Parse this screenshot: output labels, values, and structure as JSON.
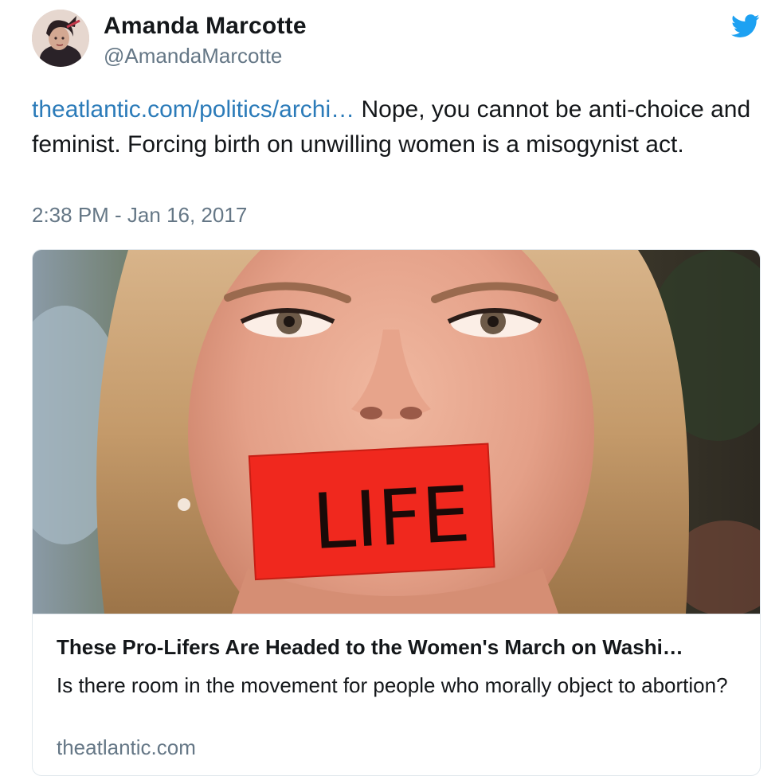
{
  "author": {
    "display_name": "Amanda Marcotte",
    "handle": "@AmandaMarcotte"
  },
  "tweet": {
    "link_text": "theatlantic.com/politics/archi…",
    "body_text": " Nope, you cannot be anti-choice and feminist. Forcing birth on unwilling women is a misogynist act.",
    "timestamp": "2:38 PM - Jan 16, 2017"
  },
  "card": {
    "image_tape_text": "LIFE",
    "title": "These Pro-Lifers Are Headed to the Women's March on Washi…",
    "description": "Is there room in the movement for people who morally object to abortion?",
    "domain": "theatlantic.com"
  },
  "icons": {
    "brand": "twitter-bird-icon",
    "brand_color": "#1da1f2"
  },
  "colors": {
    "link": "#2b7bb9",
    "secondary_text": "#657786",
    "primary_text": "#14171a",
    "border": "#e1e8ed",
    "tape": "#f0281e"
  }
}
